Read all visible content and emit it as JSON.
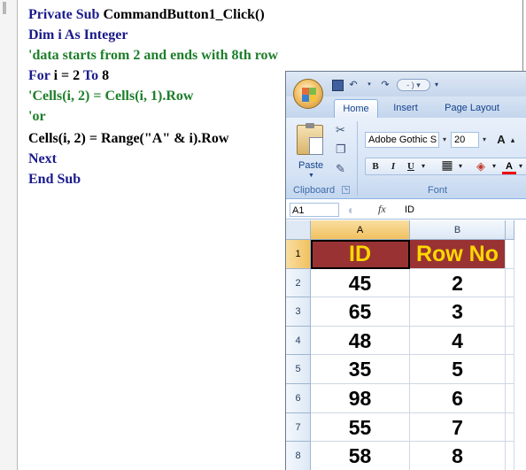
{
  "code": {
    "lines": [
      {
        "parts": [
          {
            "t": "Private Sub ",
            "c": "kw"
          },
          {
            "t": "CommandButton1_Click()",
            "c": ""
          }
        ]
      },
      {
        "parts": [
          {
            "t": "Dim i As Integer",
            "c": "kw"
          }
        ]
      },
      {
        "parts": [
          {
            "t": "'data starts from 2 and ends with 8th row",
            "c": "cm"
          }
        ]
      },
      {
        "parts": [
          {
            "t": "For ",
            "c": "kw"
          },
          {
            "t": "i = 2 ",
            "c": ""
          },
          {
            "t": "To ",
            "c": "kw"
          },
          {
            "t": "8",
            "c": ""
          }
        ]
      },
      {
        "parts": [
          {
            "t": "'Cells(i, 2) = Cells(i, 1).Row",
            "c": "cm"
          }
        ]
      },
      {
        "parts": [
          {
            "t": "'or",
            "c": "cm"
          }
        ]
      },
      {
        "parts": [
          {
            "t": "Cells(i, 2) = Range(\"A\" & i).Row",
            "c": ""
          }
        ]
      },
      {
        "parts": [
          {
            "t": "Next",
            "c": "kw"
          }
        ]
      },
      {
        "parts": [
          {
            "t": "End Sub",
            "c": "kw"
          }
        ]
      }
    ]
  },
  "excel": {
    "tabs": [
      "Home",
      "Insert",
      "Page Layout"
    ],
    "active_tab": "Home",
    "clipboard": {
      "paste_label": "Paste",
      "group_label": "Clipboard"
    },
    "font": {
      "name": "Adobe Gothic S",
      "size": "20",
      "grow_label": "A",
      "bold": "B",
      "italic": "I",
      "underline": "U",
      "font_color": "A",
      "group_label": "Font"
    },
    "name_box": "A1",
    "fx_label": "fx",
    "formula_value": "ID",
    "columns": [
      "A",
      "B"
    ],
    "rows": [
      "1",
      "2",
      "3",
      "4",
      "5",
      "6",
      "7",
      "8"
    ],
    "header_row": [
      "ID",
      "Row No"
    ],
    "data_rows": [
      [
        "45",
        "2"
      ],
      [
        "65",
        "3"
      ],
      [
        "48",
        "4"
      ],
      [
        "35",
        "5"
      ],
      [
        "98",
        "6"
      ],
      [
        "55",
        "7"
      ],
      [
        "58",
        "8"
      ]
    ],
    "header_fill": "#993333",
    "header_text_color": "#ffd800"
  }
}
